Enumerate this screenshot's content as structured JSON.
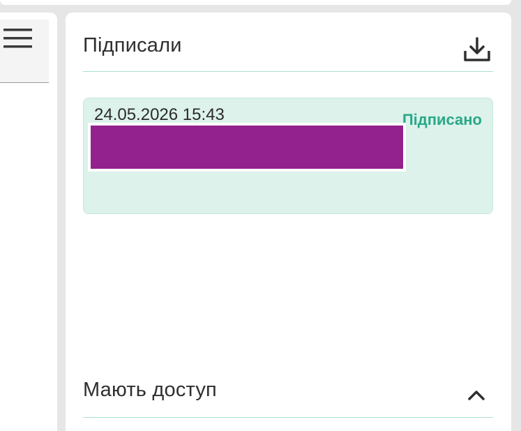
{
  "left_panel": {
    "menu_icon": "hamburger-menu-icon"
  },
  "signed_section": {
    "title": "Підписали",
    "download_icon": "download-icon",
    "entries": [
      {
        "date": "24.05.2026 15:43",
        "status": "Підписано",
        "status_color": "#2aa889",
        "signer_name_redacted": true,
        "redaction_color": "#93218e"
      }
    ]
  },
  "access_section": {
    "title": "Мають доступ",
    "toggle_icon": "chevron-up-icon",
    "expanded": true
  },
  "colors": {
    "card_background": "#dcf2ea",
    "divider": "#a9e0cf",
    "panel_background": "#ffffff",
    "page_background": "#e6e6e6"
  }
}
